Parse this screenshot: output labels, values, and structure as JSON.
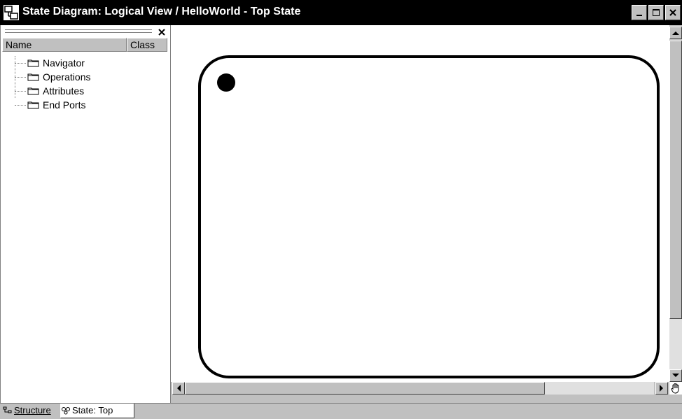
{
  "window": {
    "title": "State Diagram: Logical View / HelloWorld - Top State",
    "buttons": [
      "minimize",
      "maximize",
      "close"
    ]
  },
  "sidebar": {
    "columns": {
      "name": "Name",
      "class": "Class"
    },
    "items": [
      {
        "label": "Navigator",
        "icon": "folder-icon"
      },
      {
        "label": "Operations",
        "icon": "folder-icon"
      },
      {
        "label": "Attributes",
        "icon": "folder-icon"
      },
      {
        "label": "End Ports",
        "icon": "folder-icon"
      }
    ]
  },
  "tabs": [
    {
      "label": "Structure",
      "icon": "structure-icon",
      "active": true
    },
    {
      "label": "State: Top",
      "icon": "state-icon",
      "active": false
    }
  ],
  "colors": {
    "titlebar": "#000000",
    "chrome": "#c0c0c0",
    "canvas": "#ffffff"
  }
}
